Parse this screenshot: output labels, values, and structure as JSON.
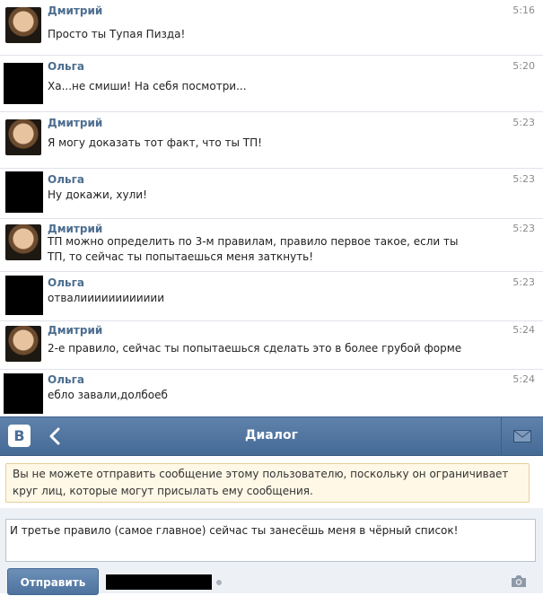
{
  "messages": [
    {
      "author": "Дмитрий",
      "time": "5:16",
      "text": "Просто ты Тупая Пизда!",
      "avatar": "photo"
    },
    {
      "author": "Ольга",
      "time": "5:20",
      "text": "Ха...не смиши! На себя посмотри...",
      "avatar": "black"
    },
    {
      "author": "Дмитрий",
      "time": "5:23",
      "text": "Я могу доказать тот факт, что ты ТП!",
      "avatar": "photo"
    },
    {
      "author": "Ольга",
      "time": "5:23",
      "text": "Ну докажи, хули!",
      "avatar": "black"
    },
    {
      "author": "Дмитрий",
      "time": "5:23",
      "text": "ТП можно определить по 3-м правилам, правило первое такое, если ты ТП, то сейчас ты попытаешься меня заткнуть!",
      "avatar": "photo"
    },
    {
      "author": "Ольга",
      "time": "5:23",
      "text": "отвалииииииииииии",
      "avatar": "black"
    },
    {
      "author": "Дмитрий",
      "time": "5:24",
      "text": "2-е правило, сейчас ты попытаешься сделать это в более грубой форме",
      "avatar": "photo"
    },
    {
      "author": "Ольга",
      "time": "5:24",
      "text": "ебло завали,долбоеб",
      "avatar": "black"
    }
  ],
  "navbar": {
    "logo": "B",
    "back_icon": "chevron-left-icon",
    "title": "Диалог",
    "mail_icon": "envelope-icon",
    "bg_color": "#5379a6"
  },
  "warning": {
    "text": "Вы не можете отправить сообщение этому пользователю, поскольку он ограничивает круг лиц, которые могут присылать ему сообщения."
  },
  "compose": {
    "value": "И третье правило (самое главное) сейчас ты занесёшь меня в чёрный список!",
    "send_label": "Отправить",
    "camera_icon": "camera-icon"
  }
}
